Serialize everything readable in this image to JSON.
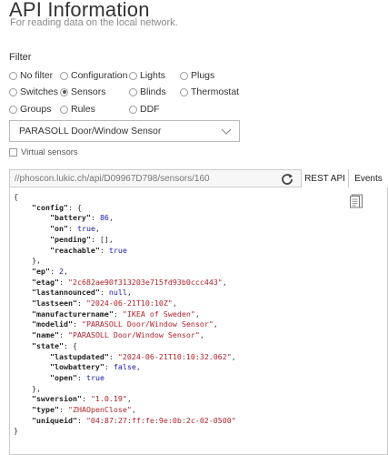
{
  "header": {
    "title": "API Information",
    "subtitle": "For reading data on the local network."
  },
  "filter": {
    "label": "Filter",
    "options": [
      {
        "label": "No filter",
        "selected": false
      },
      {
        "label": "Configuration",
        "selected": false
      },
      {
        "label": "Lights",
        "selected": false
      },
      {
        "label": "Plugs",
        "selected": false
      },
      {
        "label": "Switches",
        "selected": false
      },
      {
        "label": "Sensors",
        "selected": true
      },
      {
        "label": "Blinds",
        "selected": false
      },
      {
        "label": "Thermostat",
        "selected": false
      },
      {
        "label": "Groups",
        "selected": false
      },
      {
        "label": "Rules",
        "selected": false
      },
      {
        "label": "DDF",
        "selected": false
      }
    ]
  },
  "device_select": {
    "value": "PARASOLL Door/Window Sensor"
  },
  "virtual_sensors": {
    "label": "Virtual sensors",
    "checked": false
  },
  "toolbar": {
    "url": "//phoscon.lukic.ch/api/D09967D798/sensors/160",
    "rest_api_label": "REST API",
    "events_label": "Events"
  },
  "json_lines": [
    [
      [
        "p",
        "{"
      ]
    ],
    [
      [
        "p",
        "    "
      ],
      [
        "k",
        "\"config\""
      ],
      [
        "p",
        ": {"
      ]
    ],
    [
      [
        "p",
        "        "
      ],
      [
        "k",
        "\"battery\""
      ],
      [
        "p",
        ": "
      ],
      [
        "n",
        "86"
      ],
      [
        "p",
        ","
      ]
    ],
    [
      [
        "p",
        "        "
      ],
      [
        "k",
        "\"on\""
      ],
      [
        "p",
        ": "
      ],
      [
        "b",
        "true"
      ],
      [
        "p",
        ","
      ]
    ],
    [
      [
        "p",
        "        "
      ],
      [
        "k",
        "\"pending\""
      ],
      [
        "p",
        ": [],"
      ]
    ],
    [
      [
        "p",
        "        "
      ],
      [
        "k",
        "\"reachable\""
      ],
      [
        "p",
        ": "
      ],
      [
        "b",
        "true"
      ]
    ],
    [
      [
        "p",
        "    },"
      ]
    ],
    [
      [
        "p",
        "    "
      ],
      [
        "k",
        "\"ep\""
      ],
      [
        "p",
        ": "
      ],
      [
        "n",
        "2"
      ],
      [
        "p",
        ","
      ]
    ],
    [
      [
        "p",
        "    "
      ],
      [
        "k",
        "\"etag\""
      ],
      [
        "p",
        ": "
      ],
      [
        "s",
        "\"2c682ae90f313203e715fd93b0ccc443\""
      ],
      [
        "p",
        ","
      ]
    ],
    [
      [
        "p",
        "    "
      ],
      [
        "k",
        "\"lastannounced\""
      ],
      [
        "p",
        ": "
      ],
      [
        "b",
        "null"
      ],
      [
        "p",
        ","
      ]
    ],
    [
      [
        "p",
        "    "
      ],
      [
        "k",
        "\"lastseen\""
      ],
      [
        "p",
        ": "
      ],
      [
        "s",
        "\"2024-06-21T10:10Z\""
      ],
      [
        "p",
        ","
      ]
    ],
    [
      [
        "p",
        "    "
      ],
      [
        "k",
        "\"manufacturername\""
      ],
      [
        "p",
        ": "
      ],
      [
        "s",
        "\"IKEA of Sweden\""
      ],
      [
        "p",
        ","
      ]
    ],
    [
      [
        "p",
        "    "
      ],
      [
        "k",
        "\"modelid\""
      ],
      [
        "p",
        ": "
      ],
      [
        "s",
        "\"PARASOLL Door/Window Sensor\""
      ],
      [
        "p",
        ","
      ]
    ],
    [
      [
        "p",
        "    "
      ],
      [
        "k",
        "\"name\""
      ],
      [
        "p",
        ": "
      ],
      [
        "s",
        "\"PARASOLL Door/Window Sensor\""
      ],
      [
        "p",
        ","
      ]
    ],
    [
      [
        "p",
        "    "
      ],
      [
        "k",
        "\"state\""
      ],
      [
        "p",
        ": {"
      ]
    ],
    [
      [
        "p",
        "        "
      ],
      [
        "k",
        "\"lastupdated\""
      ],
      [
        "p",
        ": "
      ],
      [
        "s",
        "\"2024-06-21T10:10:32.062\""
      ],
      [
        "p",
        ","
      ]
    ],
    [
      [
        "p",
        "        "
      ],
      [
        "k",
        "\"lowbattery\""
      ],
      [
        "p",
        ": "
      ],
      [
        "b",
        "false"
      ],
      [
        "p",
        ","
      ]
    ],
    [
      [
        "p",
        "        "
      ],
      [
        "k",
        "\"open\""
      ],
      [
        "p",
        ": "
      ],
      [
        "b",
        "true"
      ]
    ],
    [
      [
        "p",
        "    },"
      ]
    ],
    [
      [
        "p",
        "    "
      ],
      [
        "k",
        "\"swversion\""
      ],
      [
        "p",
        ": "
      ],
      [
        "s",
        "\"1.0.19\""
      ],
      [
        "p",
        ","
      ]
    ],
    [
      [
        "p",
        "    "
      ],
      [
        "k",
        "\"type\""
      ],
      [
        "p",
        ": "
      ],
      [
        "s",
        "\"ZHAOpenClose\""
      ],
      [
        "p",
        ","
      ]
    ],
    [
      [
        "p",
        "    "
      ],
      [
        "k",
        "\"uniqueid\""
      ],
      [
        "p",
        ": "
      ],
      [
        "s",
        "\"04:87:27:ff:fe:9e:0b:2c-02-0500\""
      ]
    ],
    [
      [
        "p",
        "}"
      ]
    ]
  ],
  "icons": {
    "dropdown": "chevron-down-icon",
    "refresh": "refresh-icon",
    "copy": "clipboard-icon"
  }
}
